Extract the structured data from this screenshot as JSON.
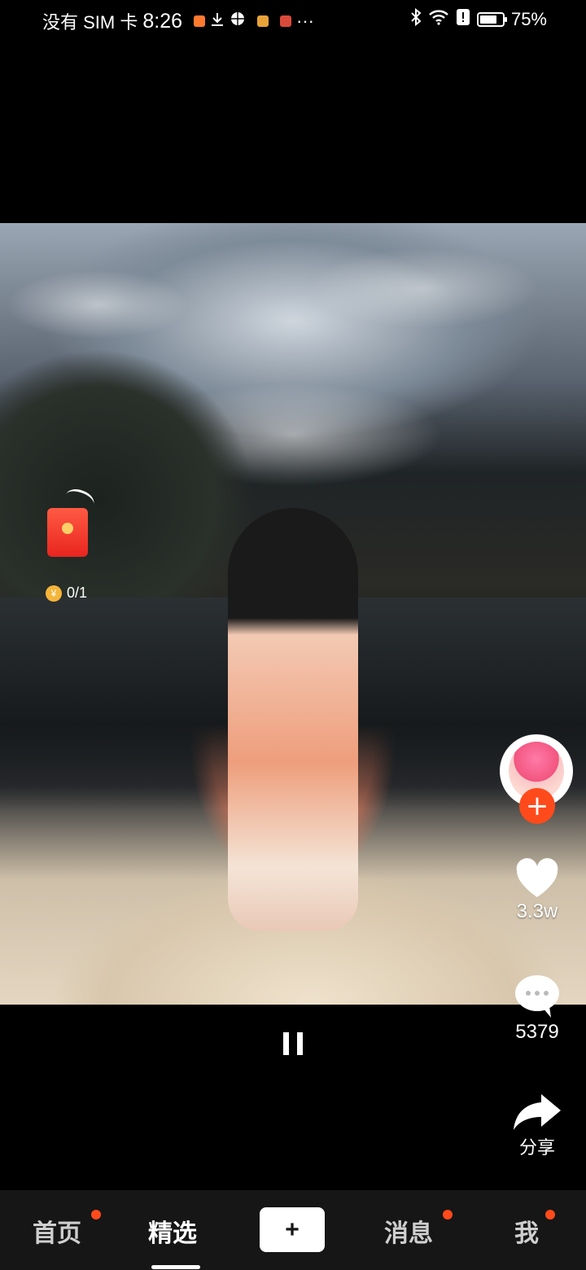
{
  "status_bar": {
    "carrier": "没有 SIM 卡",
    "time": "8:26",
    "battery": "75%",
    "battery_level": 0.75,
    "more_label": "···"
  },
  "overlay": {
    "coin_counter": "0/1"
  },
  "actions": {
    "likes": "3.3w",
    "comments": "5379",
    "share": "分享"
  },
  "bottom_nav": {
    "home": "首页",
    "featured": "精选",
    "create": "+",
    "messages": "消息",
    "me": "我"
  },
  "colors": {
    "accent": "#ff4a1c",
    "nav_background": "#161616"
  },
  "icons": [
    "bluetooth-icon",
    "wifi-icon",
    "alert-icon",
    "battery-icon",
    "heart-icon",
    "comment-icon",
    "share-icon",
    "pause-icon",
    "red-packet-icon",
    "coin-icon"
  ]
}
